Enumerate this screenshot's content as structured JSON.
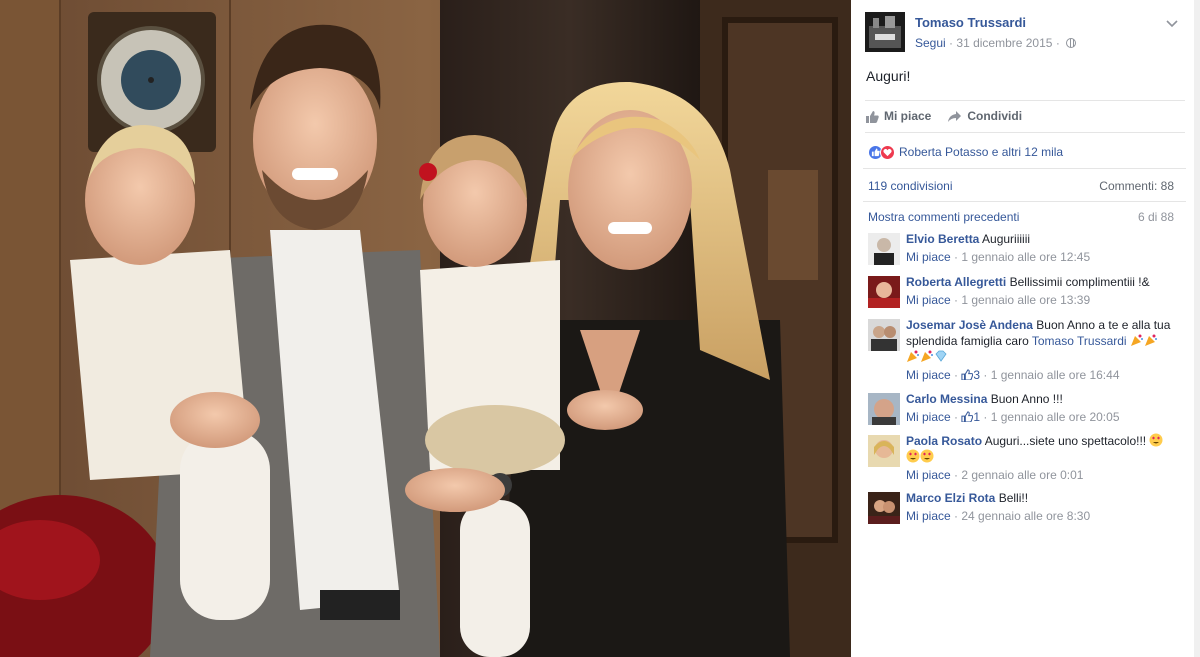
{
  "post": {
    "page_name": "Tomaso Trussardi",
    "follow_label": "Segui",
    "separator": "·",
    "date": "31 dicembre 2015",
    "separator2": "·",
    "text": "Auguri!",
    "privacy_icon": "globe-icon",
    "menu_icon": "chevron-down-icon"
  },
  "actions": {
    "like_label": "Mi piace",
    "share_label": "Condividi"
  },
  "reactions": {
    "summary": "Roberta Potasso e altri 12 mila",
    "icons": [
      "like-reaction-icon",
      "love-reaction-icon"
    ]
  },
  "stats": {
    "shares": "119 condivisioni",
    "comments": "Commenti: 88"
  },
  "comments_nav": {
    "more_label": "Mostra commenti precedenti",
    "count": "6 di 88"
  },
  "comments": [
    {
      "author": "Elvio Beretta",
      "text": "Auguriiiiii",
      "like": "Mi piace",
      "likes": "",
      "time": "1 gennaio alle ore 12:45"
    },
    {
      "author": "Roberta Allegretti",
      "text": "Bellissimii complimentiii !&",
      "like": "Mi piace",
      "likes": "",
      "time": "1 gennaio alle ore 13:39"
    },
    {
      "author": "Josemar Josè Andena",
      "text": "Buon Anno a te e alla tua splendida famiglia caro",
      "mention": "Tomaso Trussardi",
      "like": "Mi piace",
      "likes": "3",
      "time": "1 gennaio alle ore 16:44"
    },
    {
      "author": "Carlo Messina",
      "text": "Buon Anno !!!",
      "like": "Mi piace",
      "likes": "1",
      "time": "1 gennaio alle ore 20:05"
    },
    {
      "author": "Paola Rosato",
      "text": "Auguri...siete uno spettacolo!!!",
      "like": "Mi piace",
      "likes": "",
      "time": "2 gennaio alle ore 0:01"
    },
    {
      "author": "Marco Elzi Rota",
      "text": "Belli!!",
      "like": "Mi piace",
      "likes": "",
      "time": "24 gennaio alle ore 8:30"
    }
  ],
  "colors": {
    "link": "#365899",
    "meta": "#90949c",
    "like_reaction": "#4a76e8",
    "love_reaction": "#ee3a4f"
  }
}
